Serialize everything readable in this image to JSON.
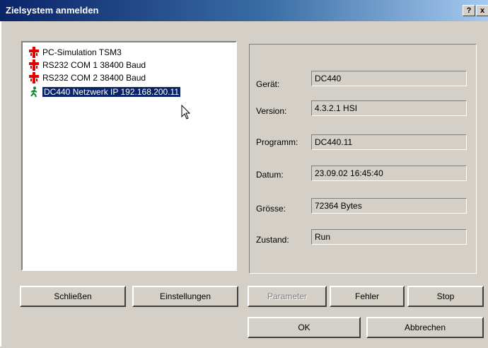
{
  "window": {
    "title": "Zielsystem anmelden",
    "help": "?",
    "close": "x"
  },
  "list": {
    "items": [
      {
        "label": "PC-Simulation TSM3",
        "icon": "plug-red-icon",
        "selected": false
      },
      {
        "label": "RS232 COM 1 38400 Baud",
        "icon": "plug-red-icon",
        "selected": false
      },
      {
        "label": "RS232 COM 2 38400 Baud",
        "icon": "plug-red-icon",
        "selected": false
      },
      {
        "label": "DC440 Netzwerk IP 192.168.200.11",
        "icon": "running-man-green-icon",
        "selected": true
      }
    ]
  },
  "info": {
    "geraet_label": "Gerät:",
    "geraet_value": "DC440",
    "version_label": "Version:",
    "version_value": "4.3.2.1 HSI",
    "programm_label": "Programm:",
    "programm_value": "DC440.11",
    "datum_label": "Datum:",
    "datum_value": "23.09.02 16:45:40",
    "groesse_label": "Grösse:",
    "groesse_value": "72364 Bytes",
    "zustand_label": "Zustand:",
    "zustand_value": "Run"
  },
  "buttons": {
    "schliessen": "Schließen",
    "einstellungen": "Einstellungen",
    "parameter": "Parameter",
    "fehler": "Fehler",
    "stop": "Stop",
    "ok": "OK",
    "abbrechen": "Abbrechen"
  },
  "colors": {
    "titlebar": "#0a246a",
    "selection": "#0a246a",
    "face": "#d4d0c8"
  }
}
